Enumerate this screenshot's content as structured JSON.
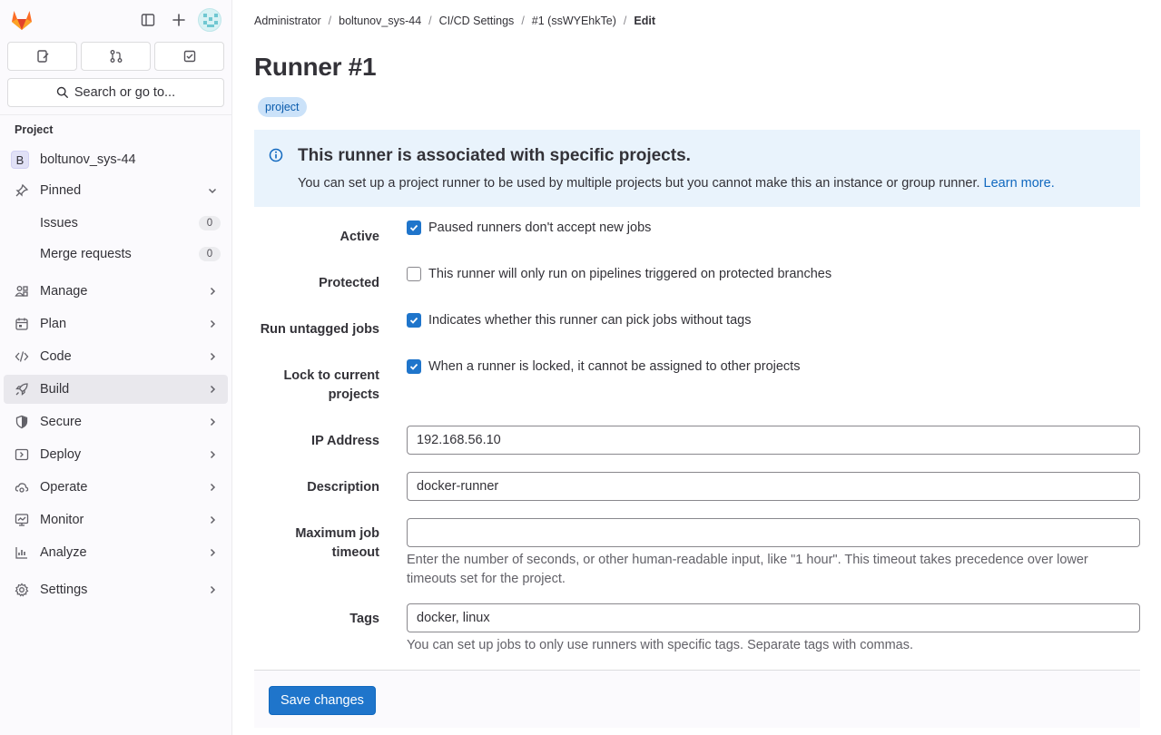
{
  "sidebar": {
    "search_label": "Search or go to...",
    "section_title": "Project",
    "project": {
      "letter": "B",
      "name": "boltunov_sys-44"
    },
    "pinned": {
      "label": "Pinned",
      "items": [
        {
          "label": "Issues",
          "count": "0"
        },
        {
          "label": "Merge requests",
          "count": "0"
        }
      ]
    },
    "menu": [
      {
        "label": "Manage",
        "icon": "users-icon"
      },
      {
        "label": "Plan",
        "icon": "planning-icon"
      },
      {
        "label": "Code",
        "icon": "code-icon"
      },
      {
        "label": "Build",
        "icon": "rocket-icon",
        "active": true
      },
      {
        "label": "Secure",
        "icon": "shield-icon"
      },
      {
        "label": "Deploy",
        "icon": "deploy-icon"
      },
      {
        "label": "Operate",
        "icon": "cloud-gear-icon"
      },
      {
        "label": "Monitor",
        "icon": "monitor-icon"
      },
      {
        "label": "Analyze",
        "icon": "chart-icon"
      },
      {
        "label": "Settings",
        "icon": "settings-icon"
      }
    ]
  },
  "breadcrumb": [
    "Administrator",
    "boltunov_sys-44",
    "CI/CD Settings",
    "#1 (ssWYEhkTe)",
    "Edit"
  ],
  "page": {
    "title": "Runner #1",
    "scope_badge": "project"
  },
  "alert": {
    "title": "This runner is associated with specific projects.",
    "body": "You can set up a project runner to be used by multiple projects but you cannot make this an instance or group runner.",
    "link": "Learn more."
  },
  "form": {
    "active": {
      "label": "Active",
      "text": "Paused runners don't accept new jobs",
      "checked": true
    },
    "protected": {
      "label": "Protected",
      "text": "This runner will only run on pipelines triggered on protected branches",
      "checked": false
    },
    "untagged": {
      "label": "Run untagged jobs",
      "text": "Indicates whether this runner can pick jobs without tags",
      "checked": true
    },
    "locked": {
      "label_line1": "Lock to current",
      "label_line2": "projects",
      "text": "When a runner is locked, it cannot be assigned to other projects",
      "checked": true
    },
    "ip": {
      "label": "IP Address",
      "value": "192.168.56.10"
    },
    "description": {
      "label": "Description",
      "value": "docker-runner"
    },
    "timeout": {
      "label_line1": "Maximum job",
      "label_line2": "timeout",
      "value": "",
      "help_line1": "Enter the number of seconds, or other human-readable input, like \"1 hour\". This timeout takes precedence over lower",
      "help_line2": "timeouts set for the project."
    },
    "tags": {
      "label": "Tags",
      "value": "docker, linux",
      "help": "You can set up jobs to only use runners with specific tags. Separate tags with commas."
    }
  },
  "footer": {
    "save_label": "Save changes"
  },
  "colors": {
    "accent": "#1f75cb",
    "alert_bg": "#e9f3fc",
    "badge_bg": "#cbe2f9"
  }
}
